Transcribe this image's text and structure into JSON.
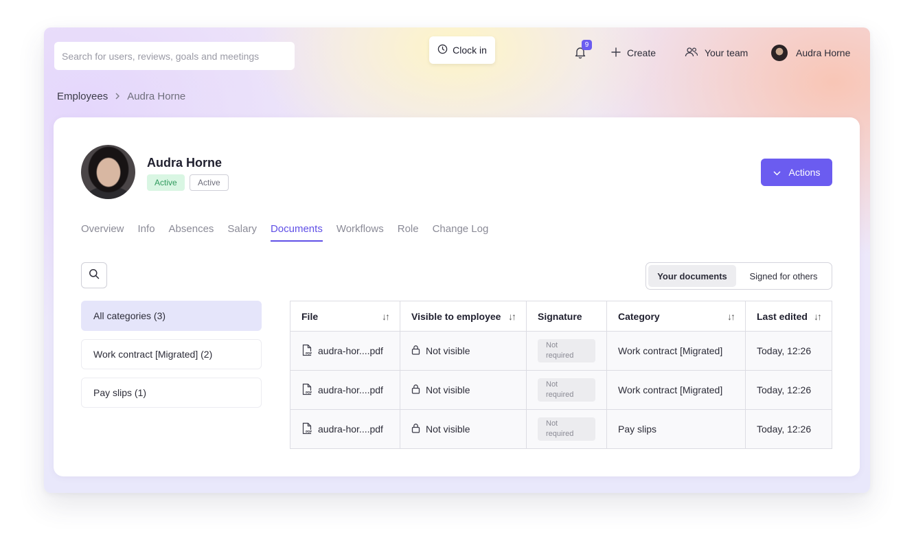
{
  "header": {
    "search_placeholder": "Search for users, reviews, goals and meetings",
    "clock_in_label": "Clock in",
    "notification_count": "9",
    "create_label": "Create",
    "your_team_label": "Your team",
    "user_name": "Audra Horne"
  },
  "breadcrumb": {
    "parent": "Employees",
    "current": "Audra Horne"
  },
  "profile": {
    "name": "Audra Horne",
    "status_badge": "Active",
    "secondary_badge": "Active",
    "actions_label": "Actions"
  },
  "tabs": [
    {
      "label": "Overview"
    },
    {
      "label": "Info"
    },
    {
      "label": "Absences"
    },
    {
      "label": "Salary"
    },
    {
      "label": "Documents",
      "active": true
    },
    {
      "label": "Workflows"
    },
    {
      "label": "Role"
    },
    {
      "label": "Change Log"
    }
  ],
  "doc_toggle": {
    "your_documents": "Your documents",
    "signed_for_others": "Signed for others"
  },
  "categories": [
    {
      "label": "All categories (3)",
      "selected": true
    },
    {
      "label": "Work contract [Migrated] (2)"
    },
    {
      "label": "Pay slips (1)"
    }
  ],
  "table": {
    "columns": [
      "File",
      "Visible to employee",
      "Signature",
      "Category",
      "Last edited"
    ],
    "rows": [
      {
        "file": "audra-hor....pdf",
        "visibility": "Not visible",
        "signature": "Not required",
        "category": "Work contract [Migrated]",
        "last_edited": "Today, 12:26"
      },
      {
        "file": "audra-hor....pdf",
        "visibility": "Not visible",
        "signature": "Not required",
        "category": "Work contract [Migrated]",
        "last_edited": "Today, 12:26"
      },
      {
        "file": "audra-hor....pdf",
        "visibility": "Not visible",
        "signature": "Not required",
        "category": "Pay slips",
        "last_edited": "Today, 12:26"
      }
    ]
  },
  "colors": {
    "accent": "#6b5cf0",
    "active_badge_bg": "#d9f6e3",
    "active_badge_text": "#2f9a5d"
  },
  "icons": [
    "clock-icon",
    "bell-icon",
    "plus-icon",
    "team-icon",
    "chevron-right-icon",
    "chevron-down-icon",
    "search-icon",
    "sort-icon",
    "pdf-file-icon",
    "lock-icon"
  ]
}
